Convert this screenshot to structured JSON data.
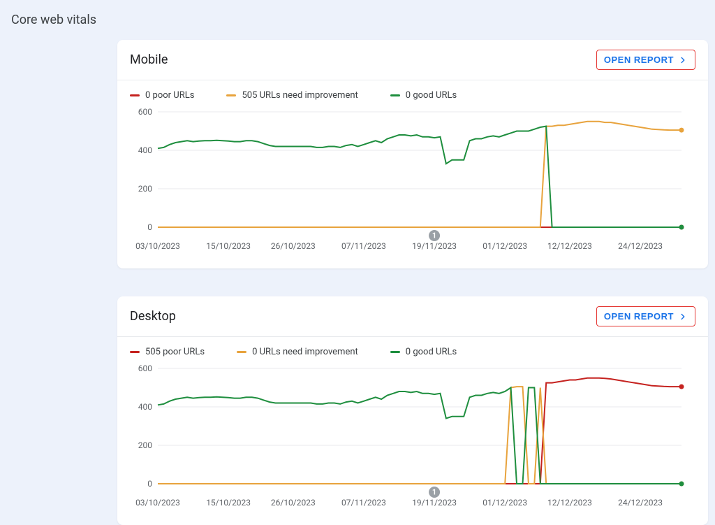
{
  "title": "Core web vitals",
  "colors": {
    "poor": "#c5221f",
    "needs_improvement": "#e8a33d",
    "good": "#1e8e3e"
  },
  "open_report_label": "OPEN REPORT",
  "panels": [
    {
      "id": "mobile",
      "title": "Mobile",
      "legend": {
        "poor": "0 poor URLs",
        "needs_improvement": "505 URLs need improvement",
        "good": "0 good URLs"
      }
    },
    {
      "id": "desktop",
      "title": "Desktop",
      "legend": {
        "poor": "505 poor URLs",
        "needs_improvement": "0 URLs need improvement",
        "good": "0 good URLs"
      }
    }
  ],
  "chart_data": [
    {
      "panel": "mobile",
      "type": "line",
      "ylim": [
        0,
        600
      ],
      "y_ticks": [
        0,
        200,
        400,
        600
      ],
      "x_labels_shown": [
        "03/10/2023",
        "15/10/2023",
        "26/10/2023",
        "07/11/2023",
        "19/11/2023",
        "01/12/2023",
        "12/12/2023",
        "24/12/2023"
      ],
      "dates": [
        "03/10/2023",
        "04/10/2023",
        "05/10/2023",
        "06/10/2023",
        "07/10/2023",
        "08/10/2023",
        "09/10/2023",
        "10/10/2023",
        "11/10/2023",
        "12/10/2023",
        "13/10/2023",
        "14/10/2023",
        "15/10/2023",
        "16/10/2023",
        "17/10/2023",
        "18/10/2023",
        "19/10/2023",
        "20/10/2023",
        "21/10/2023",
        "22/10/2023",
        "23/10/2023",
        "24/10/2023",
        "25/10/2023",
        "26/10/2023",
        "27/10/2023",
        "28/10/2023",
        "29/10/2023",
        "30/10/2023",
        "31/10/2023",
        "01/11/2023",
        "02/11/2023",
        "03/11/2023",
        "04/11/2023",
        "05/11/2023",
        "06/11/2023",
        "07/11/2023",
        "08/11/2023",
        "09/11/2023",
        "10/11/2023",
        "11/11/2023",
        "12/11/2023",
        "13/11/2023",
        "14/11/2023",
        "15/11/2023",
        "16/11/2023",
        "17/11/2023",
        "18/11/2023",
        "19/11/2023",
        "20/11/2023",
        "21/11/2023",
        "22/11/2023",
        "23/11/2023",
        "24/11/2023",
        "25/11/2023",
        "26/11/2023",
        "27/11/2023",
        "28/11/2023",
        "29/11/2023",
        "30/11/2023",
        "01/12/2023",
        "02/12/2023",
        "03/12/2023",
        "04/12/2023",
        "05/12/2023",
        "06/12/2023",
        "07/12/2023",
        "08/12/2023",
        "09/12/2023",
        "10/12/2023",
        "11/12/2023",
        "12/12/2023",
        "13/12/2023",
        "14/12/2023",
        "15/12/2023",
        "16/12/2023",
        "17/12/2023",
        "18/12/2023",
        "19/12/2023",
        "20/12/2023",
        "21/12/2023",
        "22/12/2023",
        "23/12/2023",
        "24/12/2023",
        "25/12/2023",
        "26/12/2023",
        "27/12/2023",
        "28/12/2023",
        "29/12/2023",
        "30/12/2023",
        "31/12/2023"
      ],
      "series": [
        {
          "name": "poor",
          "values": [
            0,
            0,
            0,
            0,
            0,
            0,
            0,
            0,
            0,
            0,
            0,
            0,
            0,
            0,
            0,
            0,
            0,
            0,
            0,
            0,
            0,
            0,
            0,
            0,
            0,
            0,
            0,
            0,
            0,
            0,
            0,
            0,
            0,
            0,
            0,
            0,
            0,
            0,
            0,
            0,
            0,
            0,
            0,
            0,
            0,
            0,
            0,
            0,
            0,
            0,
            0,
            0,
            0,
            0,
            0,
            0,
            0,
            0,
            0,
            0,
            0,
            0,
            0,
            0,
            0,
            0,
            0,
            0,
            0,
            0,
            0,
            0,
            0,
            0,
            0,
            0,
            0,
            0,
            0,
            0,
            0,
            0,
            0,
            0,
            0,
            0,
            0,
            0,
            0,
            0
          ]
        },
        {
          "name": "needs_improvement",
          "values": [
            0,
            0,
            0,
            0,
            0,
            0,
            0,
            0,
            0,
            0,
            0,
            0,
            0,
            0,
            0,
            0,
            0,
            0,
            0,
            0,
            0,
            0,
            0,
            0,
            0,
            0,
            0,
            0,
            0,
            0,
            0,
            0,
            0,
            0,
            0,
            0,
            0,
            0,
            0,
            0,
            0,
            0,
            0,
            0,
            0,
            0,
            0,
            0,
            0,
            0,
            0,
            0,
            0,
            0,
            0,
            0,
            0,
            0,
            0,
            0,
            0,
            0,
            0,
            0,
            0,
            0,
            525,
            525,
            530,
            530,
            535,
            540,
            545,
            550,
            550,
            550,
            545,
            545,
            540,
            535,
            530,
            525,
            520,
            515,
            510,
            508,
            506,
            505,
            505,
            505
          ]
        },
        {
          "name": "good",
          "values": [
            410,
            415,
            430,
            440,
            445,
            450,
            445,
            448,
            450,
            450,
            452,
            450,
            448,
            445,
            445,
            450,
            450,
            445,
            435,
            425,
            420,
            420,
            420,
            420,
            420,
            420,
            420,
            415,
            415,
            420,
            420,
            415,
            425,
            430,
            420,
            430,
            440,
            450,
            440,
            460,
            470,
            480,
            480,
            475,
            480,
            470,
            470,
            465,
            470,
            330,
            350,
            350,
            350,
            450,
            460,
            460,
            470,
            475,
            470,
            480,
            490,
            500,
            500,
            500,
            510,
            520,
            525,
            0,
            0,
            0,
            0,
            0,
            0,
            0,
            0,
            0,
            0,
            0,
            0,
            0,
            0,
            0,
            0,
            0,
            0,
            0,
            0,
            0,
            0,
            0
          ]
        }
      ],
      "annotations": [
        {
          "label": "1",
          "date": "19/11/2023"
        }
      ]
    },
    {
      "panel": "desktop",
      "type": "line",
      "ylim": [
        0,
        600
      ],
      "y_ticks": [
        0,
        200,
        400,
        600
      ],
      "x_labels_shown": [
        "03/10/2023",
        "15/10/2023",
        "26/10/2023",
        "07/11/2023",
        "19/11/2023",
        "01/12/2023",
        "12/12/2023",
        "24/12/2023"
      ],
      "dates": [
        "03/10/2023",
        "04/10/2023",
        "05/10/2023",
        "06/10/2023",
        "07/10/2023",
        "08/10/2023",
        "09/10/2023",
        "10/10/2023",
        "11/10/2023",
        "12/10/2023",
        "13/10/2023",
        "14/10/2023",
        "15/10/2023",
        "16/10/2023",
        "17/10/2023",
        "18/10/2023",
        "19/10/2023",
        "20/10/2023",
        "21/10/2023",
        "22/10/2023",
        "23/10/2023",
        "24/10/2023",
        "25/10/2023",
        "26/10/2023",
        "27/10/2023",
        "28/10/2023",
        "29/10/2023",
        "30/10/2023",
        "31/10/2023",
        "01/11/2023",
        "02/11/2023",
        "03/11/2023",
        "04/11/2023",
        "05/11/2023",
        "06/11/2023",
        "07/11/2023",
        "08/11/2023",
        "09/11/2023",
        "10/11/2023",
        "11/11/2023",
        "12/11/2023",
        "13/11/2023",
        "14/11/2023",
        "15/11/2023",
        "16/11/2023",
        "17/11/2023",
        "18/11/2023",
        "19/11/2023",
        "20/11/2023",
        "21/11/2023",
        "22/11/2023",
        "23/11/2023",
        "24/11/2023",
        "25/11/2023",
        "26/11/2023",
        "27/11/2023",
        "28/11/2023",
        "29/11/2023",
        "30/11/2023",
        "01/12/2023",
        "02/12/2023",
        "03/12/2023",
        "04/12/2023",
        "05/12/2023",
        "06/12/2023",
        "07/12/2023",
        "08/12/2023",
        "09/12/2023",
        "10/12/2023",
        "11/12/2023",
        "12/12/2023",
        "13/12/2023",
        "14/12/2023",
        "15/12/2023",
        "16/12/2023",
        "17/12/2023",
        "18/12/2023",
        "19/12/2023",
        "20/12/2023",
        "21/12/2023",
        "22/12/2023",
        "23/12/2023",
        "24/12/2023",
        "25/12/2023",
        "26/12/2023",
        "27/12/2023",
        "28/12/2023",
        "29/12/2023",
        "30/12/2023",
        "31/12/2023"
      ],
      "series": [
        {
          "name": "poor",
          "values": [
            0,
            0,
            0,
            0,
            0,
            0,
            0,
            0,
            0,
            0,
            0,
            0,
            0,
            0,
            0,
            0,
            0,
            0,
            0,
            0,
            0,
            0,
            0,
            0,
            0,
            0,
            0,
            0,
            0,
            0,
            0,
            0,
            0,
            0,
            0,
            0,
            0,
            0,
            0,
            0,
            0,
            0,
            0,
            0,
            0,
            0,
            0,
            0,
            0,
            0,
            0,
            0,
            0,
            0,
            0,
            0,
            0,
            0,
            0,
            0,
            0,
            0,
            0,
            0,
            0,
            0,
            525,
            525,
            530,
            535,
            540,
            540,
            545,
            550,
            550,
            550,
            548,
            545,
            540,
            535,
            530,
            525,
            520,
            515,
            510,
            508,
            506,
            505,
            505,
            505
          ]
        },
        {
          "name": "needs_improvement",
          "values": [
            0,
            0,
            0,
            0,
            0,
            0,
            0,
            0,
            0,
            0,
            0,
            0,
            0,
            0,
            0,
            0,
            0,
            0,
            0,
            0,
            0,
            0,
            0,
            0,
            0,
            0,
            0,
            0,
            0,
            0,
            0,
            0,
            0,
            0,
            0,
            0,
            0,
            0,
            0,
            0,
            0,
            0,
            0,
            0,
            0,
            0,
            0,
            0,
            0,
            0,
            0,
            0,
            0,
            0,
            0,
            0,
            0,
            0,
            0,
            0,
            500,
            505,
            505,
            0,
            0,
            500,
            0,
            0,
            0,
            0,
            0,
            0,
            0,
            0,
            0,
            0,
            0,
            0,
            0,
            0,
            0,
            0,
            0,
            0,
            0,
            0,
            0,
            0,
            0,
            0
          ]
        },
        {
          "name": "good",
          "values": [
            410,
            415,
            430,
            440,
            445,
            450,
            445,
            448,
            450,
            450,
            452,
            450,
            448,
            445,
            445,
            450,
            450,
            445,
            435,
            425,
            420,
            420,
            420,
            420,
            420,
            420,
            420,
            415,
            415,
            420,
            420,
            415,
            425,
            430,
            420,
            430,
            440,
            450,
            440,
            460,
            470,
            480,
            480,
            475,
            480,
            470,
            470,
            465,
            470,
            340,
            350,
            350,
            350,
            450,
            460,
            460,
            470,
            475,
            470,
            480,
            500,
            0,
            0,
            500,
            500,
            0,
            0,
            0,
            0,
            0,
            0,
            0,
            0,
            0,
            0,
            0,
            0,
            0,
            0,
            0,
            0,
            0,
            0,
            0,
            0,
            0,
            0,
            0,
            0,
            0
          ]
        }
      ],
      "annotations": [
        {
          "label": "1",
          "date": "19/11/2023"
        }
      ]
    }
  ]
}
